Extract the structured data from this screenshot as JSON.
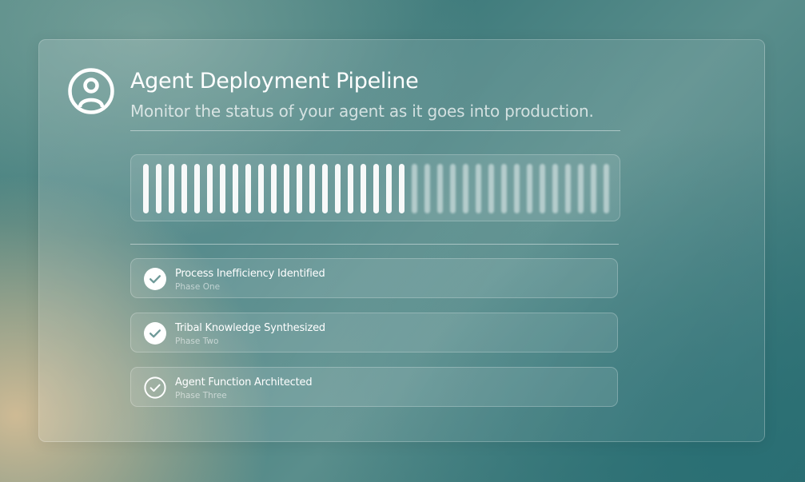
{
  "header": {
    "title": "Agent Deployment Pipeline",
    "subtitle": "Monitor the status of your agent as it goes into production.",
    "icon": "user-circle-icon"
  },
  "progress": {
    "total_segments": 37,
    "completed_segments": 21,
    "fraction": 0.57
  },
  "phases": [
    {
      "label": "Process Inefficiency Identified",
      "phase": "Phase One",
      "status": "complete",
      "icon": "check-circle-filled-icon"
    },
    {
      "label": "Tribal Knowledge Synthesized",
      "phase": "Phase Two",
      "status": "complete",
      "icon": "check-circle-filled-icon"
    },
    {
      "label": "Agent Function Architected",
      "phase": "Phase Three",
      "status": "in-progress",
      "icon": "check-circle-outline-icon"
    }
  ],
  "colors": {
    "accent_active": "#f7f9f9",
    "background_teal": "#3f7b7c",
    "background_sand": "#d6be96"
  }
}
